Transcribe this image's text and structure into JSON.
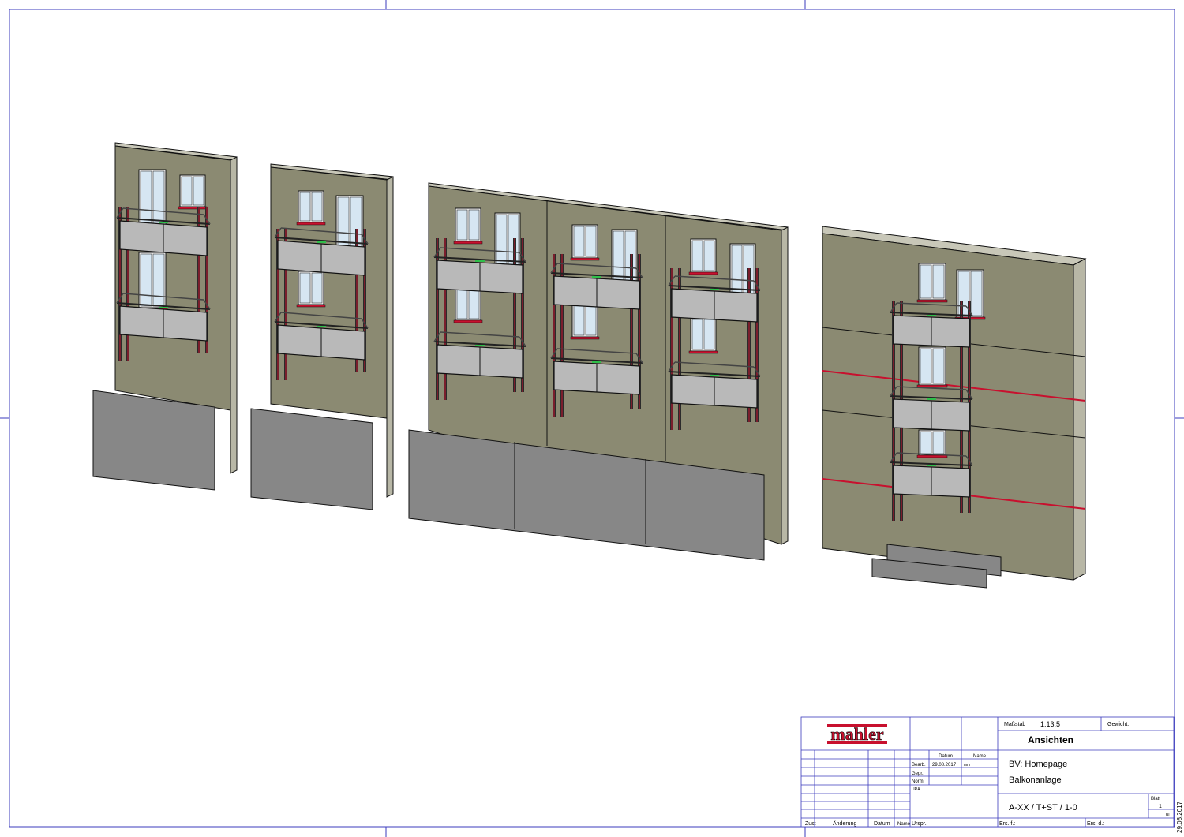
{
  "title_block": {
    "logo_text": "mahler",
    "scale_label": "Maßstab",
    "scale_value": "1:13,5",
    "weight_label": "Gewicht:",
    "drawing_title": "Ansichten",
    "project_line": "BV: Homepage",
    "subject_line": "Balkonanlage",
    "drawing_number": "A-XX / T+ST  / 1-0",
    "sheet_label": "Blatt",
    "sheet_value": "1",
    "sheet_sub": "Bl.",
    "col_date": "Datum",
    "col_name": "Name",
    "row_bearb": "Bearb.",
    "row_gepr": "Gepr.",
    "row_norm": "Norm",
    "row_blank": "URA",
    "bearb_date": "29.08.2017",
    "bearb_name": "mm",
    "rev_zust": "Zust",
    "rev_aend": "Änderung",
    "rev_datum": "Datum",
    "rev_name": "Name",
    "rev_urspr": "Urspr.",
    "ers_fuer": "Ers. f.:",
    "ers_durch": "Ers. d.:",
    "side_date": "29.08.2017"
  },
  "colors": {
    "wall": "#8b8a72",
    "wall_top": "#c8c7b8",
    "plinth": "#878787",
    "frame_red": "#c8102e",
    "glass": "#d6e6f2",
    "panel": "#b9b9b9"
  }
}
